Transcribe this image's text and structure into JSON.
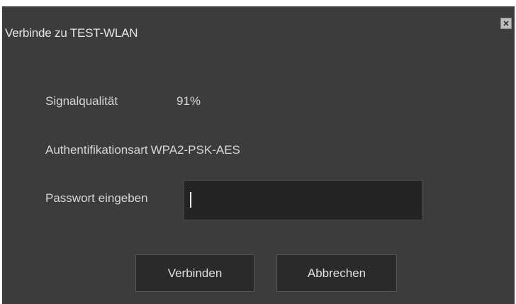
{
  "dialog": {
    "title": "Verbinde zu TEST-WLAN",
    "close_icon": "close-icon"
  },
  "info": {
    "signal_label": "Signalqualität",
    "signal_value": "91%",
    "auth_label": "Authentifikationsart",
    "auth_value": "WPA2-PSK-AES"
  },
  "password": {
    "label": "Passwort eingeben",
    "value": ""
  },
  "buttons": {
    "connect_label": "Verbinden",
    "cancel_label": "Abbrechen"
  },
  "colors": {
    "dialog_bg": "#3c3c3c",
    "input_bg": "#242424",
    "button_bg": "#2a2a2a",
    "text": "#d6d6d6"
  }
}
